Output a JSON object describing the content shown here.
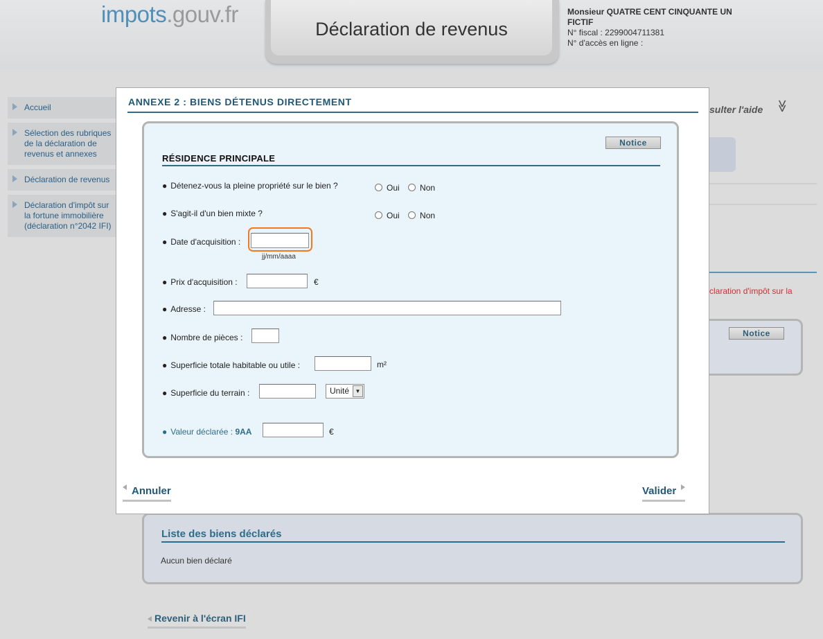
{
  "header": {
    "logo_main": "impots",
    "logo_suffix": ".gouv.fr",
    "title": "Déclaration de revenus",
    "user_name": "Monsieur QUATRE CENT CINQUANTE UN FICTIF",
    "fiscal_number": "N° fiscal : 2299004711381",
    "access_number": "N° d'accès en ligne :"
  },
  "sidebar": {
    "items": [
      {
        "label": "Accueil"
      },
      {
        "label": "Sélection des rubriques de la déclaration de revenus et annexes"
      },
      {
        "label": "Déclaration de revenus"
      },
      {
        "label": "Déclaration d'impôt sur la fortune immobilière (déclaration n°2042 IFI)"
      }
    ]
  },
  "background": {
    "help_link": "sulter l'aide",
    "help_chevron": "≫",
    "red_text": "claration d'impôt sur la",
    "notice_label": "Notice",
    "list_title": "Liste des biens déclarés",
    "list_empty": "Aucun bien déclaré",
    "back_link": "Revenir à l'écran IFI"
  },
  "modal": {
    "title": "ANNEXE 2 : BIENS DÉTENUS DIRECTEMENT",
    "notice_label": "Notice",
    "section_title": "RÉSIDENCE PRINCIPALE",
    "bullet": "●",
    "q_full_ownership": "Détenez-vous la pleine propriété sur le bien ?",
    "q_mixed": "S'agit-il d'un bien mixte ?",
    "yes": "Oui",
    "no": "Non",
    "date_label": "Date d'acquisition :",
    "date_value": "",
    "date_hint": "jj/mm/aaaa",
    "price_label": "Prix d'acquisition :",
    "price_value": "",
    "euro": "€",
    "address_label": "Adresse :",
    "address_value": "",
    "rooms_label": "Nombre de pièces :",
    "rooms_value": "",
    "living_area_label": "Superficie totale habitable ou utile :",
    "living_area_value": "",
    "living_area_unit": "m²",
    "land_area_label": "Superficie du terrain :",
    "land_area_value": "",
    "unit_select_value": "Unité",
    "declared_value_label": "Valeur déclarée :",
    "declared_value_code": "9AA",
    "declared_value": "",
    "cancel_label": "Annuler",
    "validate_label": "Valider"
  }
}
